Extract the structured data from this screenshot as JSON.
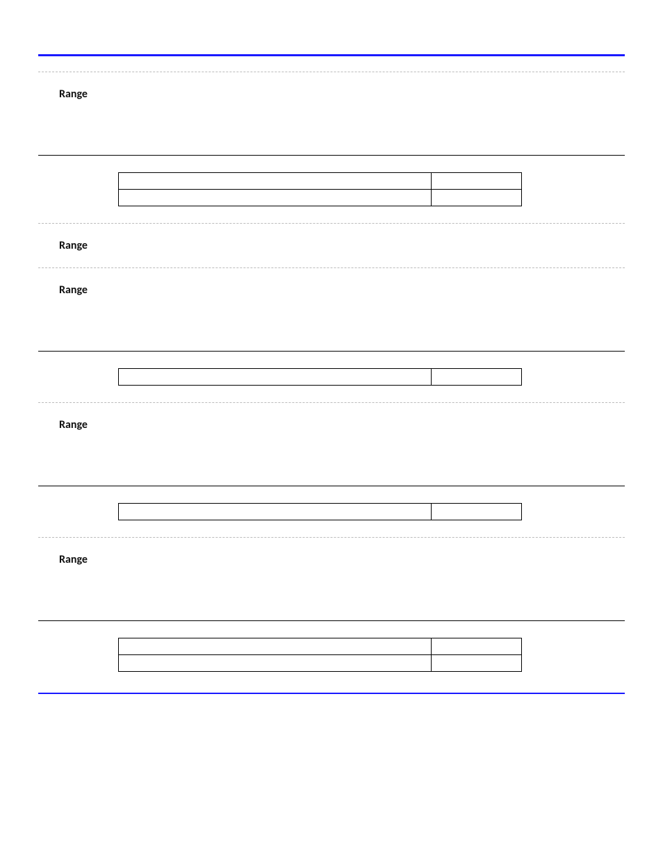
{
  "labels": {
    "range": "Range"
  },
  "sections": [
    {
      "rangeLabel": "range",
      "tableRows": 2
    },
    {
      "rangeLabel": "range",
      "tableRows": 0
    },
    {
      "rangeLabel": "range",
      "tableRows": 1
    },
    {
      "rangeLabel": "range",
      "tableRows": 1
    },
    {
      "rangeLabel": "range",
      "tableRows": 2
    }
  ]
}
